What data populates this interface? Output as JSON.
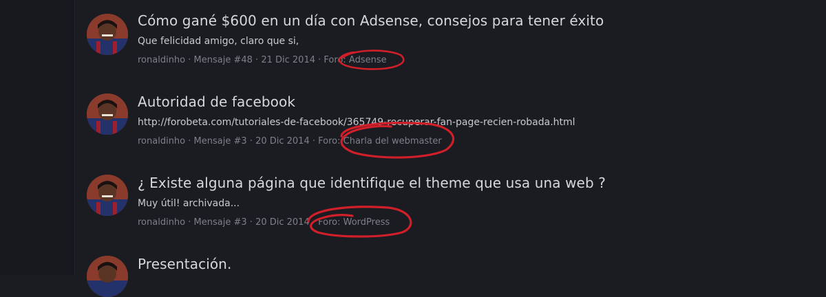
{
  "results": [
    {
      "title": "Cómo gané $600 en un día con Adsense, consejos para tener éxito",
      "snippet": "Que felicidad amigo, claro que si,",
      "author": "ronaldinho",
      "message": "Mensaje #48",
      "date": "21 Dic 2014",
      "forum": "Foro: Adsense"
    },
    {
      "title": "Autoridad de facebook",
      "snippet": "http://forobeta.com/tutoriales-de-facebook/365749-recuperar-fan-page-recien-robada.html",
      "author": "ronaldinho",
      "message": "Mensaje #3",
      "date": "20 Dic 2014",
      "forum": "Foro: Charla del webmaster"
    },
    {
      "title": "¿ Existe alguna página que identifique el theme que usa una web ?",
      "snippet": "Muy útil! archivada...",
      "author": "ronaldinho",
      "message": "Mensaje #3",
      "date": "20 Dic 2014",
      "forum": "Foro: WordPress"
    },
    {
      "title": "Presentación."
    }
  ],
  "separator": " · ",
  "colors": {
    "background": "#1b1c22",
    "title": "#d6d7dc",
    "meta": "#7e8089",
    "annotation": "#d11f2a"
  }
}
